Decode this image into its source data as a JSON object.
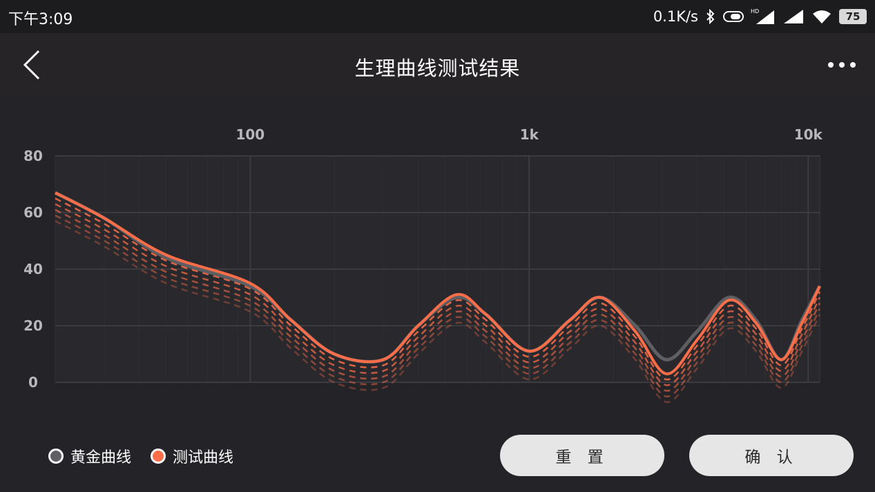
{
  "status_bar": {
    "time": "下午3:09",
    "net_speed": "0.1K/s",
    "battery": "75",
    "icons": [
      "bluetooth-icon",
      "toggle-icon",
      "hd-signal-icon",
      "signal-icon",
      "wifi-icon",
      "battery-icon"
    ]
  },
  "app_bar": {
    "title": "生理曲线测试结果",
    "back_icon": "chevron-left-icon",
    "more_icon": "more-dots-icon"
  },
  "legend": {
    "golden_label": "黄金曲线",
    "test_label": "测试曲线"
  },
  "buttons": {
    "reset_label": "重 置",
    "confirm_label": "确 认"
  },
  "colors": {
    "background": "#242428",
    "golden_curve": "#5f5f63",
    "test_curve": "#ff6e48",
    "grid": "#3a3a3e",
    "tick_label": "#b8b8bc"
  },
  "chart_data": {
    "type": "line",
    "x_scale": "log",
    "x_ticks": [
      {
        "label": "100",
        "value": 100
      },
      {
        "label": "1k",
        "value": 1000
      },
      {
        "label": "10k",
        "value": 10000
      }
    ],
    "y_ticks": [
      0,
      20,
      40,
      60,
      80
    ],
    "xlim": [
      20,
      11000
    ],
    "ylim": [
      0,
      80
    ],
    "legend_position": "bottom-left",
    "series": [
      {
        "name": "黄金曲线",
        "color": "#5f5f63",
        "x": [
          20,
          30,
          50,
          100,
          140,
          200,
          300,
          400,
          550,
          700,
          1000,
          1400,
          1800,
          2400,
          3100,
          4000,
          5200,
          6500,
          8000,
          9500,
          11000
        ],
        "y": [
          67,
          58,
          44,
          34,
          22,
          10,
          8,
          20,
          30,
          24,
          11,
          22,
          30,
          20,
          8,
          18,
          30,
          22,
          8,
          22,
          34
        ]
      },
      {
        "name": "测试曲线",
        "color": "#ff6e48",
        "x": [
          20,
          30,
          50,
          100,
          140,
          200,
          300,
          400,
          550,
          700,
          1000,
          1400,
          1800,
          2400,
          3100,
          4000,
          5200,
          6500,
          8000,
          9500,
          11000
        ],
        "y": [
          67,
          58,
          45,
          35,
          22,
          10,
          8,
          20,
          31,
          24,
          11,
          22,
          30,
          18,
          3,
          15,
          29,
          21,
          8,
          21,
          34
        ]
      }
    ],
    "history_offsets": [
      -2,
      -4,
      -6,
      -8,
      -10
    ]
  }
}
